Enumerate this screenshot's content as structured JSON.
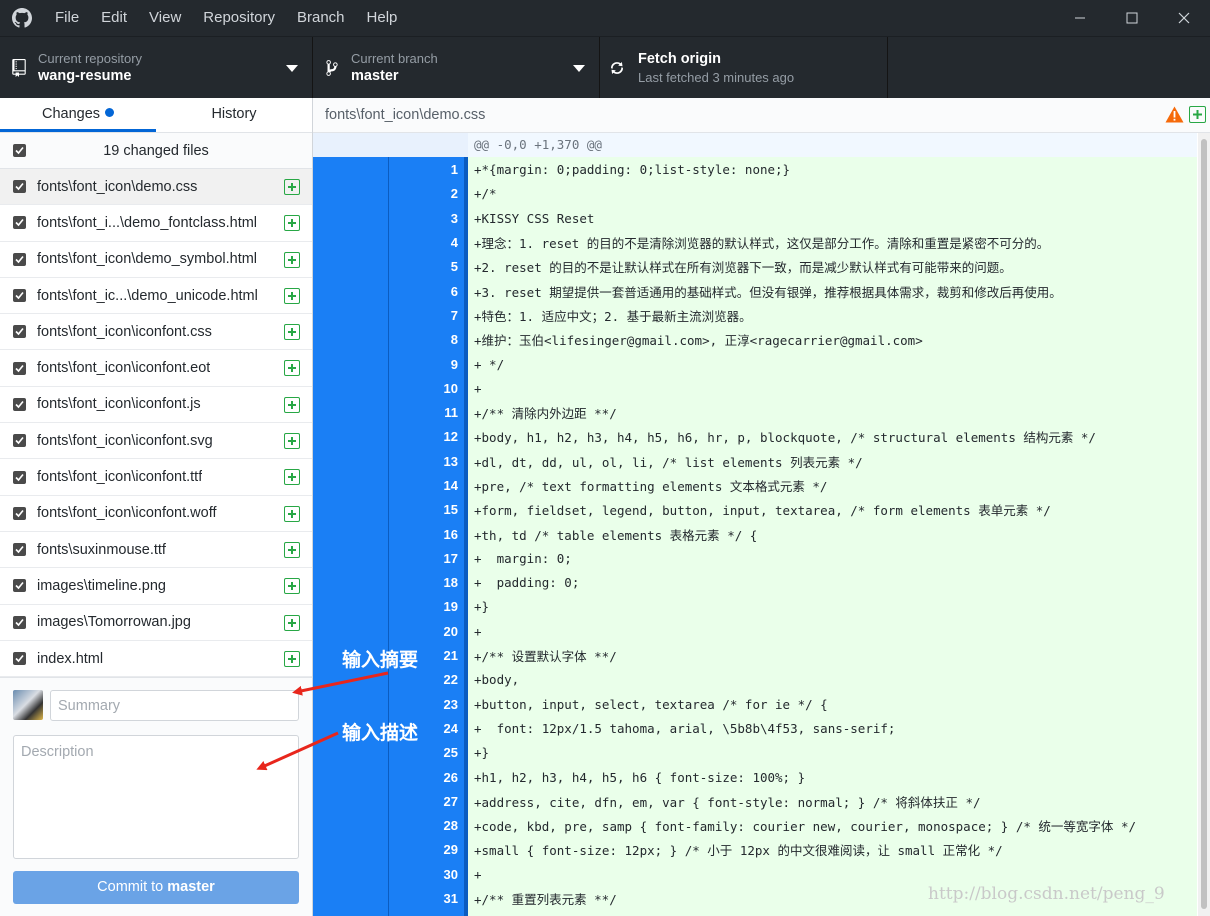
{
  "titlebar": {
    "menu": [
      "File",
      "Edit",
      "View",
      "Repository",
      "Branch",
      "Help"
    ],
    "logo_icon": "github-octocat-icon"
  },
  "toolbar": {
    "repo_caption": "Current repository",
    "repo_name": "wang-resume",
    "branch_caption": "Current branch",
    "branch_name": "master",
    "fetch_title": "Fetch origin",
    "fetch_subtitle": "Last fetched 3 minutes ago"
  },
  "sidebar": {
    "tab_changes": "Changes",
    "tab_history": "History",
    "changed_files_label": "19 changed files",
    "files": [
      {
        "path": "fonts\\font_icon\\demo.css",
        "selected": true
      },
      {
        "path": "fonts\\font_i...\\demo_fontclass.html",
        "selected": false
      },
      {
        "path": "fonts\\font_icon\\demo_symbol.html",
        "selected": false
      },
      {
        "path": "fonts\\font_ic...\\demo_unicode.html",
        "selected": false
      },
      {
        "path": "fonts\\font_icon\\iconfont.css",
        "selected": false
      },
      {
        "path": "fonts\\font_icon\\iconfont.eot",
        "selected": false
      },
      {
        "path": "fonts\\font_icon\\iconfont.js",
        "selected": false
      },
      {
        "path": "fonts\\font_icon\\iconfont.svg",
        "selected": false
      },
      {
        "path": "fonts\\font_icon\\iconfont.ttf",
        "selected": false
      },
      {
        "path": "fonts\\font_icon\\iconfont.woff",
        "selected": false
      },
      {
        "path": "fonts\\suxinmouse.ttf",
        "selected": false
      },
      {
        "path": "images\\timeline.png",
        "selected": false
      },
      {
        "path": "images\\Tomorrowan.jpg",
        "selected": false
      },
      {
        "path": "index.html",
        "selected": false
      }
    ]
  },
  "commit": {
    "summary_placeholder": "Summary",
    "description_placeholder": "Description",
    "button_prefix": "Commit to ",
    "button_branch": "master"
  },
  "diff": {
    "file_path": "fonts\\font_icon\\demo.css",
    "hunk_header": "@@ -0,0 +1,370 @@",
    "lines": [
      {
        "n": "1",
        "text": "+*{margin: 0;padding: 0;list-style: none;}"
      },
      {
        "n": "2",
        "text": "+/*"
      },
      {
        "n": "3",
        "text": "+KISSY CSS Reset"
      },
      {
        "n": "4",
        "text": "+理念：1. reset 的目的不是清除浏览器的默认样式，这仅是部分工作。清除和重置是紧密不可分的。"
      },
      {
        "n": "5",
        "text": "+2. reset 的目的不是让默认样式在所有浏览器下一致，而是减少默认样式有可能带来的问题。"
      },
      {
        "n": "6",
        "text": "+3. reset 期望提供一套普适通用的基础样式。但没有银弹，推荐根据具体需求，裁剪和修改后再使用。"
      },
      {
        "n": "7",
        "text": "+特色：1. 适应中文；2. 基于最新主流浏览器。"
      },
      {
        "n": "8",
        "text": "+维护：玉伯<lifesinger@gmail.com>, 正淳<ragecarrier@gmail.com>"
      },
      {
        "n": "9",
        "text": "+ */"
      },
      {
        "n": "10",
        "text": "+"
      },
      {
        "n": "11",
        "text": "+/** 清除内外边距 **/"
      },
      {
        "n": "12",
        "text": "+body, h1, h2, h3, h4, h5, h6, hr, p, blockquote, /* structural elements 结构元素 */"
      },
      {
        "n": "13",
        "text": "+dl, dt, dd, ul, ol, li, /* list elements 列表元素 */"
      },
      {
        "n": "14",
        "text": "+pre, /* text formatting elements 文本格式元素 */"
      },
      {
        "n": "15",
        "text": "+form, fieldset, legend, button, input, textarea, /* form elements 表单元素 */"
      },
      {
        "n": "16",
        "text": "+th, td /* table elements 表格元素 */ {"
      },
      {
        "n": "17",
        "text": "+  margin: 0;"
      },
      {
        "n": "18",
        "text": "+  padding: 0;"
      },
      {
        "n": "19",
        "text": "+}"
      },
      {
        "n": "20",
        "text": "+"
      },
      {
        "n": "21",
        "text": "+/** 设置默认字体 **/"
      },
      {
        "n": "22",
        "text": "+body,"
      },
      {
        "n": "23",
        "text": "+button, input, select, textarea /* for ie */ {"
      },
      {
        "n": "24",
        "text": "+  font: 12px/1.5 tahoma, arial, \\5b8b\\4f53, sans-serif;"
      },
      {
        "n": "25",
        "text": "+}"
      },
      {
        "n": "26",
        "text": "+h1, h2, h3, h4, h5, h6 { font-size: 100%; }"
      },
      {
        "n": "27",
        "text": "+address, cite, dfn, em, var { font-style: normal; } /* 将斜体扶正 */"
      },
      {
        "n": "28",
        "text": "+code, kbd, pre, samp { font-family: courier new, courier, monospace; } /* 统一等宽字体 */"
      },
      {
        "n": "29",
        "text": "+small { font-size: 12px; } /* 小于 12px 的中文很难阅读，让 small 正常化 */"
      },
      {
        "n": "30",
        "text": "+"
      },
      {
        "n": "31",
        "text": "+/** 重置列表元素 **/"
      }
    ]
  },
  "annotations": {
    "summary_hint": "输入摘要",
    "description_hint": "输入描述",
    "arrow_color": "#e8261c"
  },
  "watermark": "http://blog.csdn.net/peng_9",
  "colors": {
    "accent": "#0366d6",
    "added": "#28a745",
    "gutter": "#1a7ff5",
    "warning": "#f66a0a"
  }
}
